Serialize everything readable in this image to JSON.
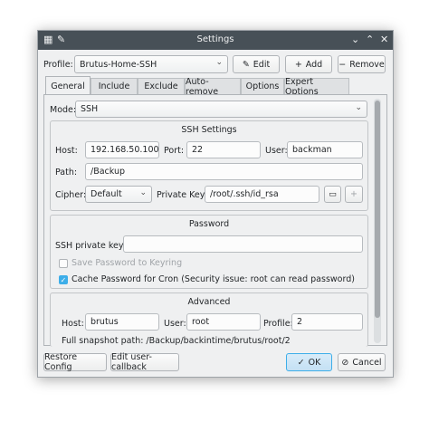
{
  "window": {
    "title": "Settings"
  },
  "profile": {
    "label": "Profile:",
    "value": "Brutus-Home-SSH",
    "edit_label": "Edit",
    "add_label": "Add",
    "remove_label": "Remove"
  },
  "tabs": [
    {
      "label": "General"
    },
    {
      "label": "Include"
    },
    {
      "label": "Exclude"
    },
    {
      "label": "Auto-remove"
    },
    {
      "label": "Options"
    },
    {
      "label": "Expert Options"
    }
  ],
  "mode": {
    "label": "Mode:",
    "value": "SSH"
  },
  "ssh_settings": {
    "title": "SSH Settings",
    "host_label": "Host:",
    "host_value": "192.168.50.100",
    "port_label": "Port:",
    "port_value": "22",
    "user_label": "User:",
    "user_value": "backman",
    "path_label": "Path:",
    "path_value": "/Backup",
    "cipher_label": "Cipher:",
    "cipher_value": "Default",
    "private_key_label": "Private Key:",
    "private_key_value": "/root/.ssh/id_rsa",
    "add_key_label": "+"
  },
  "password": {
    "title": "Password",
    "ssh_private_key_label": "SSH private key:",
    "save_keyring_label": "Save Password to Keyring",
    "cache_cron_label": "Cache Password for Cron (Security issue: root can read password)"
  },
  "advanced": {
    "title": "Advanced",
    "host_label": "Host:",
    "host_value": "brutus",
    "user_label": "User:",
    "user_value": "root",
    "profile_label": "Profile:",
    "profile_value": "2",
    "snapshot_path": "Full snapshot path: /Backup/backintime/brutus/root/2"
  },
  "footer": {
    "restore_label": "Restore Config",
    "edit_callback_label": "Edit user-callback",
    "ok_label": "OK",
    "cancel_label": "Cancel"
  },
  "colors": {
    "titlebar": "#475057",
    "accent": "#3daee9",
    "window_bg": "#eff0f1"
  }
}
